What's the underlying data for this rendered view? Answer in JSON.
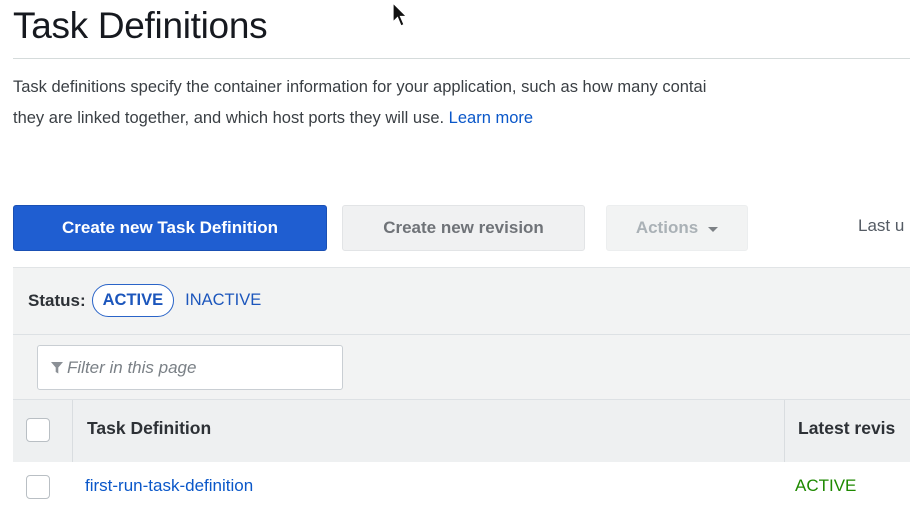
{
  "page": {
    "title": "Task Definitions",
    "description_line1": "Task definitions specify the container information for your application, such as how many contai",
    "description_line2": "they are linked together, and which host ports they will use. ",
    "learn_more": "Learn more"
  },
  "toolbar": {
    "create_label": "Create new Task Definition",
    "revision_label": "Create new revision",
    "actions_label": "Actions",
    "last_updated_partial": "Last u"
  },
  "status_filter": {
    "label": "Status:",
    "active": "ACTIVE",
    "inactive": "INACTIVE"
  },
  "filter": {
    "placeholder": "Filter in this page",
    "value": ""
  },
  "table": {
    "columns": [
      "Task Definition",
      "Latest revis"
    ],
    "rows": [
      {
        "name": "first-run-task-definition",
        "status": "ACTIVE"
      }
    ]
  },
  "colors": {
    "primary": "#1f5ed1",
    "link": "#0a57c9",
    "status_active": "#1e8900"
  },
  "icons": [
    "cursor-arrow-icon",
    "caret-down-icon",
    "filter-funnel-icon"
  ]
}
